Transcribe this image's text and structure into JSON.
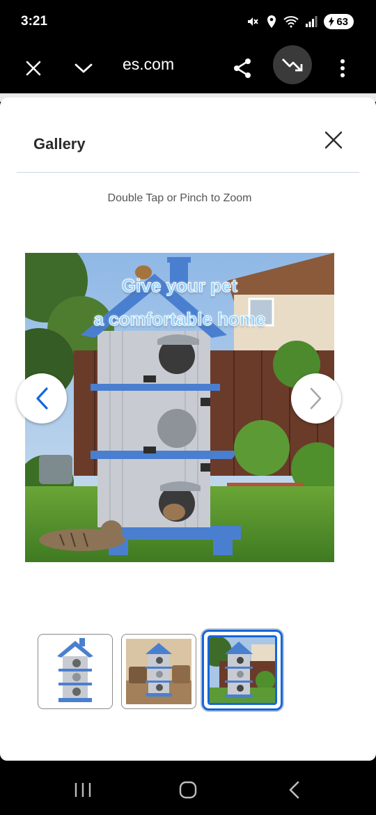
{
  "status_bar": {
    "time": "3:21",
    "battery": "63",
    "icons": [
      "mute-icon",
      "location-icon",
      "wifi-icon",
      "signal-icon",
      "battery-icon"
    ]
  },
  "browser": {
    "url_fragment": "es.com",
    "buttons": [
      "close-icon",
      "chevron-down-icon",
      "share-icon",
      "trending-down-icon",
      "more-vertical-icon"
    ]
  },
  "gallery": {
    "title": "Gallery",
    "hint": "Double Tap or Pinch to Zoom",
    "image_text_line1": "Give your pet",
    "image_text_line2": "a comfortable home",
    "selected_thumbnail": 3,
    "thumbnail_count": 3
  },
  "colors": {
    "accent_blue": "#1466d9",
    "house_blue": "#4a7fd0",
    "house_gray": "#c8ccd2"
  }
}
